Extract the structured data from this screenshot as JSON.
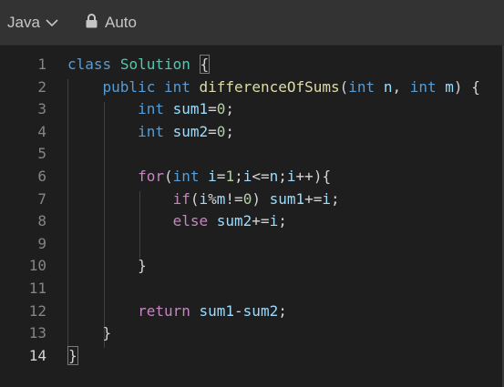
{
  "toolbar": {
    "language": "Java",
    "mode": "Auto"
  },
  "editor": {
    "active_line": "14",
    "lines": [
      {
        "n": "1",
        "tokens": [
          {
            "t": "kw",
            "v": "class"
          },
          {
            "t": "pl",
            "v": " "
          },
          {
            "t": "cls",
            "v": "Solution"
          },
          {
            "t": "pl",
            "v": " {"
          }
        ]
      },
      {
        "n": "2",
        "tokens": [
          {
            "t": "pl",
            "v": "    "
          },
          {
            "t": "kw",
            "v": "public"
          },
          {
            "t": "pl",
            "v": " "
          },
          {
            "t": "kw",
            "v": "int"
          },
          {
            "t": "pl",
            "v": " "
          },
          {
            "t": "fn",
            "v": "differenceOfSums"
          },
          {
            "t": "pl",
            "v": "("
          },
          {
            "t": "kw",
            "v": "int"
          },
          {
            "t": "pl",
            "v": " "
          },
          {
            "t": "var",
            "v": "n"
          },
          {
            "t": "pl",
            "v": ", "
          },
          {
            "t": "kw",
            "v": "int"
          },
          {
            "t": "pl",
            "v": " "
          },
          {
            "t": "var",
            "v": "m"
          },
          {
            "t": "pl",
            "v": ") {"
          }
        ]
      },
      {
        "n": "3",
        "tokens": [
          {
            "t": "pl",
            "v": "        "
          },
          {
            "t": "kw",
            "v": "int"
          },
          {
            "t": "pl",
            "v": " "
          },
          {
            "t": "var",
            "v": "sum1"
          },
          {
            "t": "pl",
            "v": "="
          },
          {
            "t": "num",
            "v": "0"
          },
          {
            "t": "pl",
            "v": ";"
          }
        ]
      },
      {
        "n": "4",
        "tokens": [
          {
            "t": "pl",
            "v": "        "
          },
          {
            "t": "kw",
            "v": "int"
          },
          {
            "t": "pl",
            "v": " "
          },
          {
            "t": "var",
            "v": "sum2"
          },
          {
            "t": "pl",
            "v": "="
          },
          {
            "t": "num",
            "v": "0"
          },
          {
            "t": "pl",
            "v": ";"
          }
        ]
      },
      {
        "n": "5",
        "tokens": []
      },
      {
        "n": "6",
        "tokens": [
          {
            "t": "pl",
            "v": "        "
          },
          {
            "t": "ctl",
            "v": "for"
          },
          {
            "t": "pl",
            "v": "("
          },
          {
            "t": "kw",
            "v": "int"
          },
          {
            "t": "pl",
            "v": " "
          },
          {
            "t": "var",
            "v": "i"
          },
          {
            "t": "pl",
            "v": "="
          },
          {
            "t": "num",
            "v": "1"
          },
          {
            "t": "pl",
            "v": ";"
          },
          {
            "t": "var",
            "v": "i"
          },
          {
            "t": "pl",
            "v": "<="
          },
          {
            "t": "var",
            "v": "n"
          },
          {
            "t": "pl",
            "v": ";"
          },
          {
            "t": "var",
            "v": "i"
          },
          {
            "t": "pl",
            "v": "++){"
          }
        ]
      },
      {
        "n": "7",
        "tokens": [
          {
            "t": "pl",
            "v": "            "
          },
          {
            "t": "ctl",
            "v": "if"
          },
          {
            "t": "pl",
            "v": "("
          },
          {
            "t": "var",
            "v": "i"
          },
          {
            "t": "pl",
            "v": "%"
          },
          {
            "t": "var",
            "v": "m"
          },
          {
            "t": "pl",
            "v": "!="
          },
          {
            "t": "num",
            "v": "0"
          },
          {
            "t": "pl",
            "v": ") "
          },
          {
            "t": "var",
            "v": "sum1"
          },
          {
            "t": "pl",
            "v": "+="
          },
          {
            "t": "var",
            "v": "i"
          },
          {
            "t": "pl",
            "v": ";"
          }
        ]
      },
      {
        "n": "8",
        "tokens": [
          {
            "t": "pl",
            "v": "            "
          },
          {
            "t": "ctl",
            "v": "else"
          },
          {
            "t": "pl",
            "v": " "
          },
          {
            "t": "var",
            "v": "sum2"
          },
          {
            "t": "pl",
            "v": "+="
          },
          {
            "t": "var",
            "v": "i"
          },
          {
            "t": "pl",
            "v": ";"
          }
        ]
      },
      {
        "n": "9",
        "tokens": []
      },
      {
        "n": "10",
        "tokens": [
          {
            "t": "pl",
            "v": "        }"
          }
        ]
      },
      {
        "n": "11",
        "tokens": []
      },
      {
        "n": "12",
        "tokens": [
          {
            "t": "pl",
            "v": "        "
          },
          {
            "t": "ctl",
            "v": "return"
          },
          {
            "t": "pl",
            "v": " "
          },
          {
            "t": "var",
            "v": "sum1"
          },
          {
            "t": "pl",
            "v": "-"
          },
          {
            "t": "var",
            "v": "sum2"
          },
          {
            "t": "pl",
            "v": ";"
          }
        ]
      },
      {
        "n": "13",
        "tokens": [
          {
            "t": "pl",
            "v": "    }"
          }
        ]
      },
      {
        "n": "14",
        "tokens": [
          {
            "t": "pl",
            "v": "}"
          }
        ]
      }
    ]
  }
}
